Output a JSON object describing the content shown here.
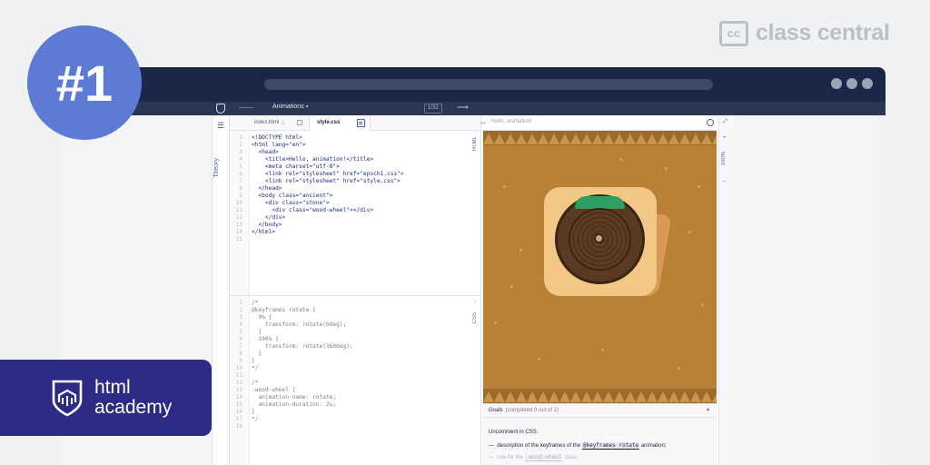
{
  "badge": "#1",
  "brand": {
    "cc_mark": "cc",
    "name": "class central"
  },
  "toolbar": {
    "lesson_title": "Animations",
    "step": "1/32"
  },
  "theory": {
    "label": "Theory"
  },
  "tabs": [
    {
      "label": "index.html",
      "active": false
    },
    {
      "label": "style.css",
      "active": true
    }
  ],
  "html_pane": {
    "label": "HTML",
    "code": [
      "<!DOCTYPE html>",
      "<html lang=\"en\">",
      "  <head>",
      "    <title>Hello, animation!</title>",
      "    <meta charset=\"utf-8\">",
      "    <link rel=\"stylesheet\" href=\"epoch1.css\">",
      "    <link rel=\"stylesheet\" href=\"style.css\">",
      "  </head>",
      "  <body class=\"ancient\">",
      "    <div class=\"stone\">",
      "      <div class=\"wood-wheel\"></div>",
      "    </div>",
      "  </body>",
      "</html>",
      ""
    ]
  },
  "css_pane": {
    "label": "CSS",
    "code": [
      "/*",
      "@keyframes rotate {",
      "  0% {",
      "    transform: rotate(0deg);",
      "  }",
      "  100% {",
      "    transform: rotate(360deg);",
      "  }",
      "}",
      "*/",
      "",
      "/*",
      ".wood-wheel {",
      "  animation-name: rotate;",
      "  animation-duration: 2s;",
      "}",
      "*/",
      ""
    ]
  },
  "preview": {
    "title": "Hello, animation!",
    "zoom": "100%"
  },
  "goals": {
    "heading": "Goals",
    "progress": "(completed 0 out of 2)",
    "intro": "Uncomment in CSS:",
    "items": [
      {
        "prefix": "—",
        "before": "description of the keyframes of the ",
        "code": "@keyframes rotate",
        "after": " animation;",
        "done": false
      },
      {
        "prefix": "—",
        "before": "rule for the ",
        "code": ".wood-wheel",
        "after": " class.",
        "done": false
      }
    ]
  },
  "academy": {
    "line1": "html",
    "line2": "academy"
  },
  "colors": {
    "badge": "#5d7ad4",
    "titlebar": "#1a2848",
    "academy": "#2d2b86",
    "accent": "#3f56c4",
    "stage": "#b98136"
  }
}
